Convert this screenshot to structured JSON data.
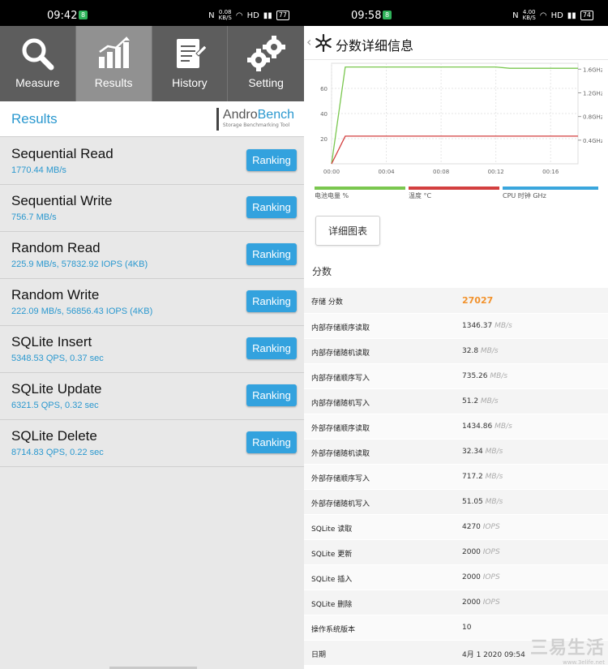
{
  "left": {
    "status": {
      "time": "09:42",
      "badge": "8",
      "speed_top": "0.08",
      "speed_bottom": "KB/S",
      "net": "HD",
      "battery": "77"
    },
    "tabs": [
      {
        "label": "Measure",
        "icon": "magnifier-icon"
      },
      {
        "label": "Results",
        "icon": "bar-chart-icon"
      },
      {
        "label": "History",
        "icon": "clipboard-icon"
      },
      {
        "label": "Setting",
        "icon": "gears-icon"
      }
    ],
    "active_tab": "Results",
    "results_title": "Results",
    "logo": {
      "andro": "Andro",
      "bench": "Bench",
      "sub": "Storage Benchmarking Tool"
    },
    "rank_label": "Ranking",
    "results": [
      {
        "name": "Sequential Read",
        "value": "1770.44 MB/s"
      },
      {
        "name": "Sequential Write",
        "value": "756.7 MB/s"
      },
      {
        "name": "Random Read",
        "value": "225.9 MB/s, 57832.92 IOPS (4KB)"
      },
      {
        "name": "Random Write",
        "value": "222.09 MB/s, 56856.43 IOPS (4KB)"
      },
      {
        "name": "SQLite Insert",
        "value": "5348.53 QPS, 0.37 sec"
      },
      {
        "name": "SQLite Update",
        "value": "6321.5 QPS, 0.32 sec"
      },
      {
        "name": "SQLite Delete",
        "value": "8714.83 QPS, 0.22 sec"
      }
    ]
  },
  "right": {
    "status": {
      "time": "09:58",
      "badge": "8",
      "speed_top": "4.00",
      "speed_bottom": "KB/S",
      "net": "HD",
      "battery": "74"
    },
    "title": "分数详细信息",
    "chart_data": {
      "type": "line",
      "x_ticks": [
        "00:00",
        "00:04",
        "00:08",
        "00:12",
        "00:16"
      ],
      "x_range": [
        0,
        18
      ],
      "y_left_ticks": [
        "20",
        "40",
        "60"
      ],
      "y_left_range": [
        0,
        80
      ],
      "y_right_ticks": [
        "0.4GHz",
        "0.8GHz",
        "1.2GHz",
        "1.6GHz"
      ],
      "y_right_range": [
        0,
        1.7
      ],
      "series": [
        {
          "name": "电池电量 %",
          "color": "#7ac74f",
          "x": [
            0,
            1,
            3,
            6,
            9,
            12,
            13,
            18
          ],
          "y": [
            0,
            77,
            77,
            77,
            77,
            77,
            76,
            76
          ]
        },
        {
          "name": "温度 °C",
          "color": "#d33f3f",
          "x": [
            0,
            1,
            3,
            6,
            9,
            12,
            18
          ],
          "y": [
            0,
            22,
            22,
            22,
            22,
            22,
            22
          ]
        },
        {
          "name": "CPU 时钟 GHz",
          "color": "#3aa6dd",
          "x": [],
          "y": []
        }
      ]
    },
    "detail_button": "详细图表",
    "score_heading": "分数",
    "scores": [
      {
        "label": "存储 分数",
        "value": "27027",
        "unit": "",
        "big": true
      },
      {
        "label": "内部存储顺序读取",
        "value": "1346.37",
        "unit": "MB/s"
      },
      {
        "label": "内部存储随机读取",
        "value": "32.8",
        "unit": "MB/s"
      },
      {
        "label": "内部存储顺序写入",
        "value": "735.26",
        "unit": "MB/s"
      },
      {
        "label": "内部存储随机写入",
        "value": "51.2",
        "unit": "MB/s"
      },
      {
        "label": "外部存储顺序读取",
        "value": "1434.86",
        "unit": "MB/s"
      },
      {
        "label": "外部存储随机读取",
        "value": "32.34",
        "unit": "MB/s"
      },
      {
        "label": "外部存储顺序写入",
        "value": "717.2",
        "unit": "MB/s"
      },
      {
        "label": "外部存储随机写入",
        "value": "51.05",
        "unit": "MB/s"
      },
      {
        "label": "SQLite 读取",
        "value": "4270",
        "unit": "IOPS"
      },
      {
        "label": "SQLite 更新",
        "value": "2000",
        "unit": "IOPS"
      },
      {
        "label": "SQLite 插入",
        "value": "2000",
        "unit": "IOPS"
      },
      {
        "label": "SQLite 删除",
        "value": "2000",
        "unit": "IOPS"
      },
      {
        "label": "操作系统版本",
        "value": "10",
        "unit": ""
      },
      {
        "label": "日期",
        "value": "4月 1 2020 09:54",
        "unit": ""
      }
    ],
    "watermark": {
      "main": "三易生活",
      "sub": "www.3elife.net"
    }
  }
}
